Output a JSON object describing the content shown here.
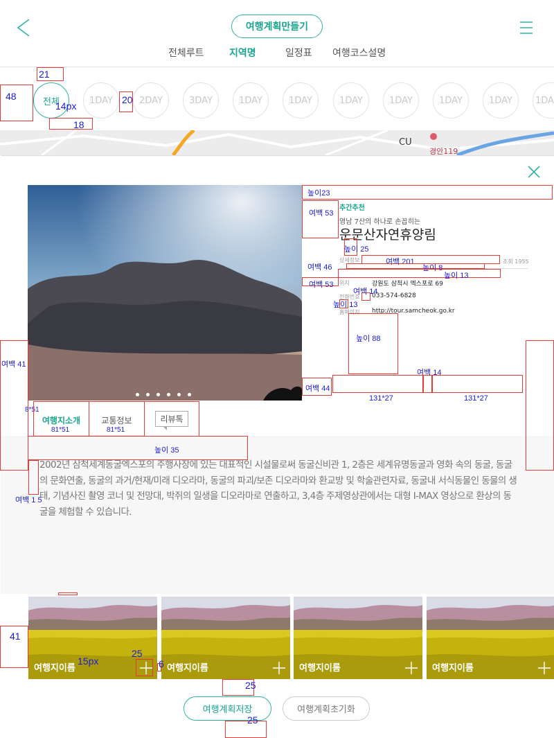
{
  "header": {
    "title": "여행계획만들기",
    "tabs": [
      "전체루트",
      "지역명",
      "일정표",
      "여행코스설명"
    ]
  },
  "days": [
    "전체",
    "1DAY",
    "2DAY",
    "3DAY",
    "1DAY",
    "1DAY",
    "1DAY",
    "1DAY",
    "1DAY",
    "1DAY",
    "1DA"
  ],
  "map": {
    "labels": [
      "CU",
      "경안119"
    ]
  },
  "detail": {
    "tag": "추간추천",
    "subtitle": "영남 7산의 하나로 손꼽히는",
    "title": "운문산자연휴양림",
    "info_label": "상세정보",
    "info_code": "조회 1955",
    "rows": [
      {
        "label": "위치",
        "value": "강원도 삼척시 엑스포로 69"
      },
      {
        "label": "전화번호",
        "value": "033-574-6828"
      },
      {
        "label": "홈페이지",
        "value": "http://tour.samcheok.go.kr"
      }
    ],
    "sub_tabs": [
      "여행지소개",
      "교통정보",
      "리뷰톡"
    ],
    "description": "2002년 삼척세계동굴엑스포의 주행사장에 있는 대표적인 시설물로써 동굴신비관 1, 2층은 세계유명동굴과 영화 속의 동굴, 동굴의 문화연출, 동굴의 과거/현재/미래 디오라마, 동굴의 파괴/보존 디오라마와 환교방 및 학술관련자료, 동굴내 서식동물인 동물의 생태, 기념사진 촬영 코너 및 전망대, 박쥐의 일생을 디오라마로 연출하고, 3,4층 주제영상관에서는 대형 I-MAX 영상으로 환상의 동굴을 체험할 수 있습니다."
  },
  "thumbnails": [
    "여행지이름",
    "여행지이름",
    "여행지이름",
    "여행지이름"
  ],
  "buttons": {
    "save": "여행계획저장",
    "reset": "여행계획초기화"
  },
  "annotations": [
    "21",
    "48",
    "14px",
    "20",
    "18",
    "높이23",
    "여백 53",
    "높이 25",
    "여백 46",
    "여백 201",
    "높이 8",
    "높이 13",
    "여백 53",
    "여백 14",
    "높이 13",
    "높이 88",
    "여백 41",
    "여백 44",
    "여백 14",
    "131*27",
    "131*27",
    "8*51",
    "81*51",
    "81*51",
    "높이 35",
    "여백 1 5",
    "41",
    "15px",
    "25",
    "6",
    "25",
    "25"
  ],
  "colors": {
    "accent": "#1aa58f",
    "annotation_box": "#e53935",
    "annotation_text": "#1a1ad6"
  }
}
